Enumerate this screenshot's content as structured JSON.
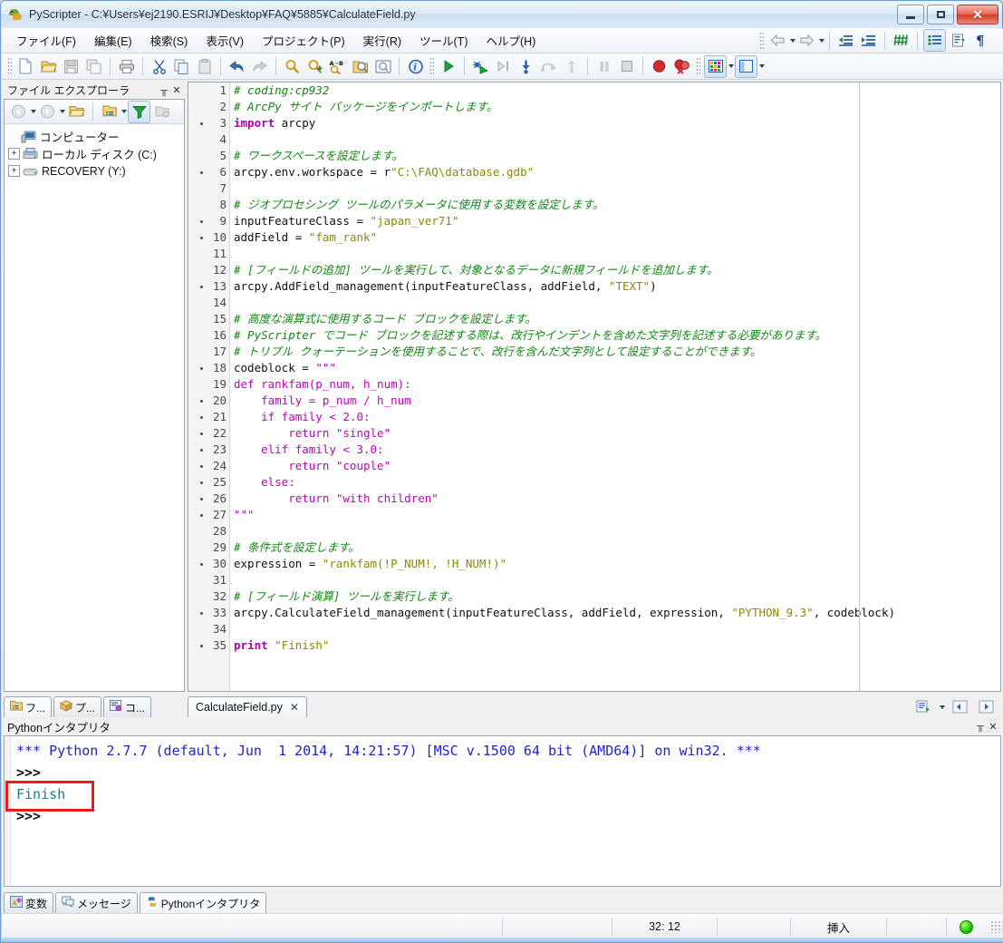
{
  "window": {
    "title": "PyScripter - C:¥Users¥ej2190.ESRIJ¥Desktop¥FAQ¥5885¥CalculateField.py",
    "app_icon": "pyscripter-icon",
    "minimize_label": "–",
    "maximize_label": "□",
    "close_label": "✕"
  },
  "menu": {
    "items": [
      {
        "label": "ファイル(F)",
        "name": "menu-file"
      },
      {
        "label": "編集(E)",
        "name": "menu-edit"
      },
      {
        "label": "検索(S)",
        "name": "menu-search"
      },
      {
        "label": "表示(V)",
        "name": "menu-view"
      },
      {
        "label": "プロジェクト(P)",
        "name": "menu-project"
      },
      {
        "label": "実行(R)",
        "name": "menu-run"
      },
      {
        "label": "ツール(T)",
        "name": "menu-tools"
      },
      {
        "label": "ヘルプ(H)",
        "name": "menu-help"
      }
    ],
    "right_icons": [
      "back-arrow-icon",
      "back-dropdown-icon",
      "forward-arrow-icon",
      "forward-dropdown-icon",
      "indent-decrease-icon",
      "indent-increase-icon",
      "hash-comment-icon",
      "toggle-list-icon",
      "sort-lines-icon",
      "pilcrow-icon"
    ]
  },
  "toolbar": {
    "icons": [
      "new-file-icon",
      "open-folder-icon",
      "save-icon",
      "save-all-icon",
      "print-icon",
      "cut-icon",
      "copy-icon",
      "paste-icon",
      "undo-icon",
      "redo-icon",
      "find-icon",
      "find-next-icon",
      "replace-icon",
      "find-in-files-icon",
      "goto-icon",
      "syntax-check-icon",
      "run-icon",
      "debug-icon",
      "step-into-icon",
      "step-over-icon",
      "step-out-icon",
      "run-to-cursor-icon",
      "pause-icon",
      "stop-icon",
      "breakpoint-icon",
      "clear-breakpoints-icon",
      "layout-icon",
      "layout-dropdown-icon",
      "panels-icon",
      "panels-dropdown-icon"
    ]
  },
  "file_explorer": {
    "title": "ファイル エクスプローラ",
    "pin_label": "╥",
    "close_label": "✕",
    "toolbar_icons": [
      "back-nav-icon",
      "back-nav-dropdown-icon",
      "forward-nav-icon",
      "forward-nav-dropdown-icon",
      "open-folder-icon",
      "browse-path-icon",
      "browse-path-dropdown-icon",
      "filter-icon",
      "explore-icon"
    ],
    "tree": [
      {
        "label": "コンピューター",
        "icon": "computer-icon",
        "expander": "",
        "indent": 0
      },
      {
        "label": "ローカル ディスク (C:)",
        "icon": "harddisk-icon",
        "expander": "+",
        "indent": 1
      },
      {
        "label": "RECOVERY (Y:)",
        "icon": "drive-icon",
        "expander": "+",
        "indent": 1
      }
    ]
  },
  "left_tabs": [
    {
      "label": "フ...",
      "icon": "file-explorer-tab-icon",
      "active": true,
      "name": "tab-file-explorer"
    },
    {
      "label": "プ...",
      "icon": "project-tab-icon",
      "active": false,
      "name": "tab-project"
    },
    {
      "label": "コ...",
      "icon": "code-explorer-tab-icon",
      "active": false,
      "name": "tab-code-explorer"
    }
  ],
  "editor": {
    "tab": {
      "label": "CalculateField.py",
      "close_label": "✕"
    },
    "tab_right_icons": [
      "new-editor-icon",
      "new-editor-dropdown-icon",
      "prev-file-icon",
      "next-file-icon"
    ],
    "lines": [
      {
        "n": 1,
        "bm": false,
        "tokens": [
          {
            "t": "# coding:cp932",
            "c": "com"
          }
        ]
      },
      {
        "n": 2,
        "bm": false,
        "tokens": [
          {
            "t": "# ArcPy サイト パッケージをインポートします。",
            "c": "com"
          }
        ]
      },
      {
        "n": 3,
        "bm": true,
        "tokens": [
          {
            "t": "import",
            "c": "kw"
          },
          {
            "t": " arcpy",
            "c": "txt"
          }
        ]
      },
      {
        "n": 4,
        "bm": false,
        "tokens": []
      },
      {
        "n": 5,
        "bm": false,
        "tokens": [
          {
            "t": "# ワークスペースを設定します。",
            "c": "com"
          }
        ]
      },
      {
        "n": 6,
        "bm": true,
        "tokens": [
          {
            "t": "arcpy.env.workspace = r",
            "c": "txt"
          },
          {
            "t": "\"C:\\FAQ\\database.gdb\"",
            "c": "str"
          }
        ]
      },
      {
        "n": 7,
        "bm": false,
        "tokens": []
      },
      {
        "n": 8,
        "bm": false,
        "tokens": [
          {
            "t": "# ジオプロセシング ツールのパラメータに使用する変数を設定します。",
            "c": "com"
          }
        ]
      },
      {
        "n": 9,
        "bm": true,
        "tokens": [
          {
            "t": "inputFeatureClass = ",
            "c": "txt"
          },
          {
            "t": "\"japan_ver71\"",
            "c": "str"
          }
        ]
      },
      {
        "n": 10,
        "bm": true,
        "tokens": [
          {
            "t": "addField = ",
            "c": "txt"
          },
          {
            "t": "\"fam_rank\"",
            "c": "str"
          }
        ]
      },
      {
        "n": 11,
        "bm": false,
        "tokens": []
      },
      {
        "n": 12,
        "bm": false,
        "tokens": [
          {
            "t": "# [フィールドの追加] ツールを実行して、対象となるデータに新規フィールドを追加します。",
            "c": "com"
          }
        ]
      },
      {
        "n": 13,
        "bm": true,
        "tokens": [
          {
            "t": "arcpy.AddField_management(inputFeatureClass, addField, ",
            "c": "txt"
          },
          {
            "t": "\"TEXT\"",
            "c": "str"
          },
          {
            "t": ")",
            "c": "txt"
          }
        ]
      },
      {
        "n": 14,
        "bm": false,
        "tokens": []
      },
      {
        "n": 15,
        "bm": false,
        "tokens": [
          {
            "t": "# 高度な演算式に使用するコード ブロックを設定します。",
            "c": "com"
          }
        ]
      },
      {
        "n": 16,
        "bm": false,
        "tokens": [
          {
            "t": "# PyScripter でコード ブロックを記述する際は、改行やインデントを含めた文字列を記述する必要があります。",
            "c": "com"
          }
        ]
      },
      {
        "n": 17,
        "bm": false,
        "tokens": [
          {
            "t": "# トリプル クォーテーションを使用することで、改行を含んだ文字列として設定することができます。",
            "c": "com"
          }
        ]
      },
      {
        "n": 18,
        "bm": true,
        "tokens": [
          {
            "t": "codeblock = ",
            "c": "txt"
          },
          {
            "t": "\"\"\"",
            "c": "strm"
          }
        ]
      },
      {
        "n": 19,
        "bm": false,
        "tokens": [
          {
            "t": "def rankfam(p_num, h_num):",
            "c": "strm"
          }
        ]
      },
      {
        "n": 20,
        "bm": true,
        "tokens": [
          {
            "t": "    family = p_num / h_num",
            "c": "strm"
          }
        ]
      },
      {
        "n": 21,
        "bm": true,
        "tokens": [
          {
            "t": "    if family < 2.0:",
            "c": "strm"
          }
        ]
      },
      {
        "n": 22,
        "bm": true,
        "tokens": [
          {
            "t": "        return \"single\"",
            "c": "strm"
          }
        ]
      },
      {
        "n": 23,
        "bm": true,
        "tokens": [
          {
            "t": "    elif family < 3.0:",
            "c": "strm"
          }
        ]
      },
      {
        "n": 24,
        "bm": true,
        "tokens": [
          {
            "t": "        return \"couple\"",
            "c": "strm"
          }
        ]
      },
      {
        "n": 25,
        "bm": true,
        "tokens": [
          {
            "t": "    else:",
            "c": "strm"
          }
        ]
      },
      {
        "n": 26,
        "bm": true,
        "tokens": [
          {
            "t": "        return \"with children\"",
            "c": "strm"
          }
        ]
      },
      {
        "n": 27,
        "bm": true,
        "tokens": [
          {
            "t": "\"\"\"",
            "c": "strm"
          }
        ]
      },
      {
        "n": 28,
        "bm": false,
        "tokens": []
      },
      {
        "n": 29,
        "bm": false,
        "tokens": [
          {
            "t": "# 条件式を設定します。",
            "c": "com"
          }
        ]
      },
      {
        "n": 30,
        "bm": true,
        "tokens": [
          {
            "t": "expression = ",
            "c": "txt"
          },
          {
            "t": "\"rankfam(!P_NUM!, !H_NUM!)\"",
            "c": "str"
          }
        ]
      },
      {
        "n": 31,
        "bm": false,
        "tokens": []
      },
      {
        "n": 32,
        "bm": false,
        "tokens": [
          {
            "t": "# [フィールド演算] ツールを実行します。",
            "c": "com"
          }
        ]
      },
      {
        "n": 33,
        "bm": true,
        "tokens": [
          {
            "t": "arcpy.CalculateField_management(inputFeatureClass, addField, expression, ",
            "c": "txt"
          },
          {
            "t": "\"PYTHON_9.3\"",
            "c": "str"
          },
          {
            "t": ", codeblock)",
            "c": "txt"
          }
        ]
      },
      {
        "n": 34,
        "bm": false,
        "tokens": []
      },
      {
        "n": 35,
        "bm": true,
        "tokens": [
          {
            "t": "print",
            "c": "kw"
          },
          {
            "t": " ",
            "c": "txt"
          },
          {
            "t": "\"Finish\"",
            "c": "str"
          }
        ]
      }
    ]
  },
  "interpreter": {
    "title": "Pythonインタプリタ",
    "pin_label": "╥",
    "close_label": "✕",
    "lines": [
      {
        "text": "*** Python 2.7.7 (default, Jun  1 2014, 14:21:57) [MSC v.1500 64 bit (AMD64)] on win32. ***",
        "style": "blue"
      },
      {
        "text": ">>>",
        "style": "prompt"
      },
      {
        "text": "Finish",
        "style": "out"
      },
      {
        "text": ">>>",
        "style": "prompt"
      }
    ],
    "highlight_target": "Finish"
  },
  "bottom_tabs": [
    {
      "label": "変数",
      "icon": "variables-tab-icon",
      "active": false,
      "name": "tab-variables"
    },
    {
      "label": "メッセージ",
      "icon": "messages-tab-icon",
      "active": false,
      "name": "tab-messages"
    },
    {
      "label": "Pythonインタプリタ",
      "icon": "python-tab-icon",
      "active": true,
      "name": "tab-python-interpreter"
    }
  ],
  "statusbar": {
    "modified": "",
    "position": "32: 12",
    "blank": "",
    "insert_mode": "挿入",
    "spacer": "",
    "led": "running-led-icon"
  },
  "colors": {
    "comment": "#128712",
    "keyword": "#b000b0",
    "string": "#8a8a00",
    "multiline_string": "#c000c0",
    "interpreter_banner": "#2222cc",
    "interpreter_output": "#1b7f7f",
    "highlight_box": "#ee1b1b",
    "accent": "#6b9bd2"
  }
}
